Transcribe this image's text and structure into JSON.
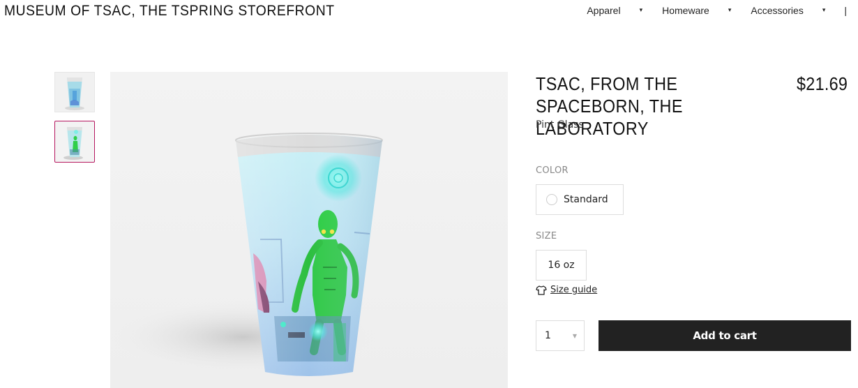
{
  "header": {
    "store_title": "MUSEUM OF TSAC, THE TSPRING STOREFRONT",
    "nav": [
      {
        "label": "Apparel",
        "icon": "caret-down-icon"
      },
      {
        "label": "Homeware",
        "icon": "caret-down-icon"
      },
      {
        "label": "Accessories",
        "icon": "caret-down-icon"
      }
    ],
    "nav_separator": "|"
  },
  "gallery": {
    "thumbnails": [
      "glass-front-thumbnail",
      "glass-alien-thumbnail"
    ],
    "selected_index": 1,
    "accent_color": "#b5165e"
  },
  "product": {
    "title": "TSAC, FROM THE SPACEBORN, THE LABORATORY",
    "price": "$21.69",
    "type": "Pint Glass",
    "color_label": "COLOR",
    "color_option": "Standard",
    "size_label": "SIZE",
    "size_option": "16 oz",
    "size_guide_label": "Size guide",
    "quantity": "1",
    "add_to_cart_label": "Add to cart"
  }
}
